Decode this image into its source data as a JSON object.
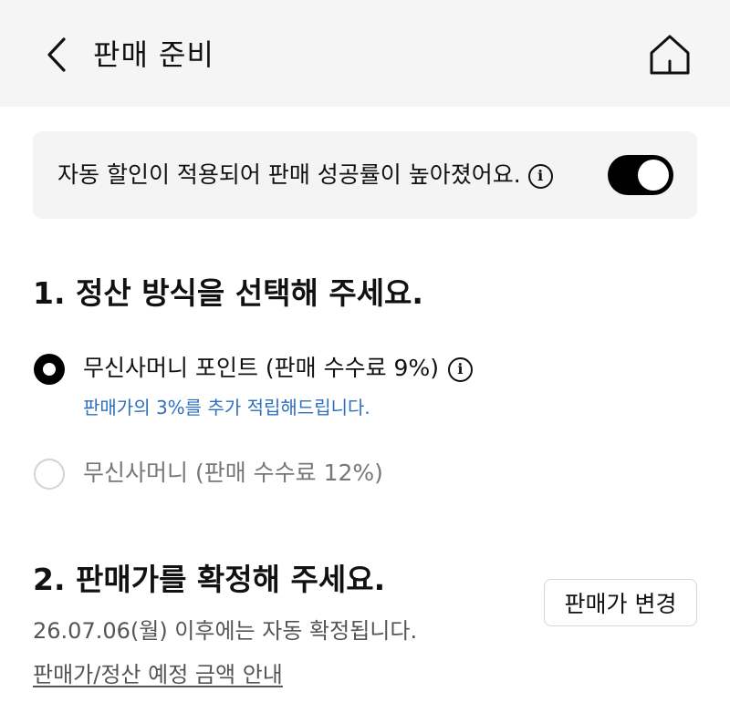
{
  "header": {
    "title": "판매 준비",
    "back_icon": "chevron-left-icon",
    "home_icon": "home-icon"
  },
  "notice": {
    "text": "자동 할인이 적용되어 판매 성공률이 높아졌어요.",
    "info_icon": "info-icon",
    "toggle_on": true
  },
  "section1": {
    "title": "1. 정산 방식을 선택해 주세요.",
    "options": [
      {
        "label": "무신사머니 포인트 (판매 수수료 9%)",
        "sublabel": "판매가의 3%를 추가 적립해드립니다.",
        "selected": true
      },
      {
        "label": "무신사머니 (판매 수수료 12%)",
        "selected": false
      }
    ]
  },
  "section2": {
    "title": "2. 판매가를 확정해 주세요.",
    "change_button": "판매가 변경",
    "description": "26.07.06(월) 이후에는 자동 확정됩니다.",
    "link": "판매가/정산 예정 금액 안내"
  },
  "colors": {
    "accent_blue": "#2f6fbf",
    "toggle_on": "#000000",
    "notice_bg": "#f4f4f4",
    "header_bg": "#f5f5f5"
  }
}
